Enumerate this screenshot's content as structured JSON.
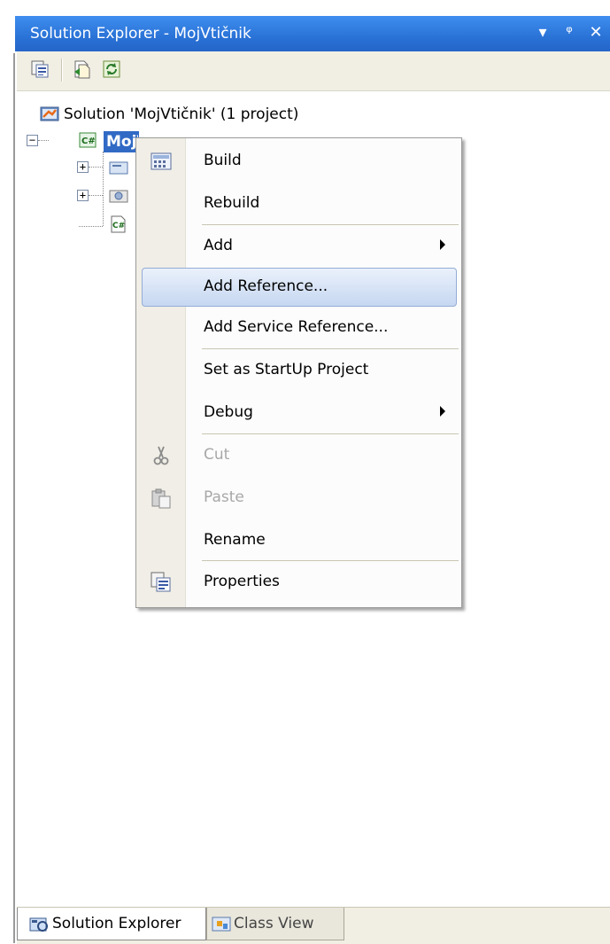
{
  "panel": {
    "title": "Solution Explorer - MojVtičnik",
    "buttons": {
      "dropdown": "▾",
      "pin": "ᵠ",
      "close": "✕"
    }
  },
  "toolbar": {
    "items": [
      {
        "icon": "properties-icon"
      },
      {
        "icon": "show-all-files-icon"
      },
      {
        "icon": "refresh-icon"
      }
    ]
  },
  "tree": {
    "solution_label": "Solution 'MojVtičnik' (1 project)",
    "project_label": "MojVtičnik"
  },
  "context_menu": {
    "items": [
      {
        "label": "Build",
        "icon": "build-icon",
        "enabled": true
      },
      {
        "label": "Rebuild",
        "enabled": true
      },
      {
        "label": "Add",
        "submenu": true,
        "enabled": true
      },
      {
        "label": "Add Reference...",
        "enabled": true,
        "highlighted": true
      },
      {
        "label": "Add Service Reference...",
        "enabled": true
      },
      {
        "label": "Set as StartUp Project",
        "enabled": true
      },
      {
        "label": "Debug",
        "submenu": true,
        "enabled": true
      },
      {
        "label": "Cut",
        "icon": "scissors-icon",
        "enabled": false
      },
      {
        "label": "Paste",
        "icon": "paste-icon",
        "enabled": false
      },
      {
        "label": "Rename",
        "enabled": true
      },
      {
        "label": "Properties",
        "icon": "properties-icon",
        "enabled": true
      }
    ]
  },
  "bottom_tabs": [
    {
      "label": "Solution Explorer",
      "icon": "solution-explorer-icon",
      "active": true
    },
    {
      "label": "Class View",
      "icon": "class-view-icon",
      "active": false
    }
  ],
  "colors": {
    "title_bar": "#2a72d6",
    "selection": "#316ac5",
    "menu_highlight": "#c6d7f1"
  }
}
